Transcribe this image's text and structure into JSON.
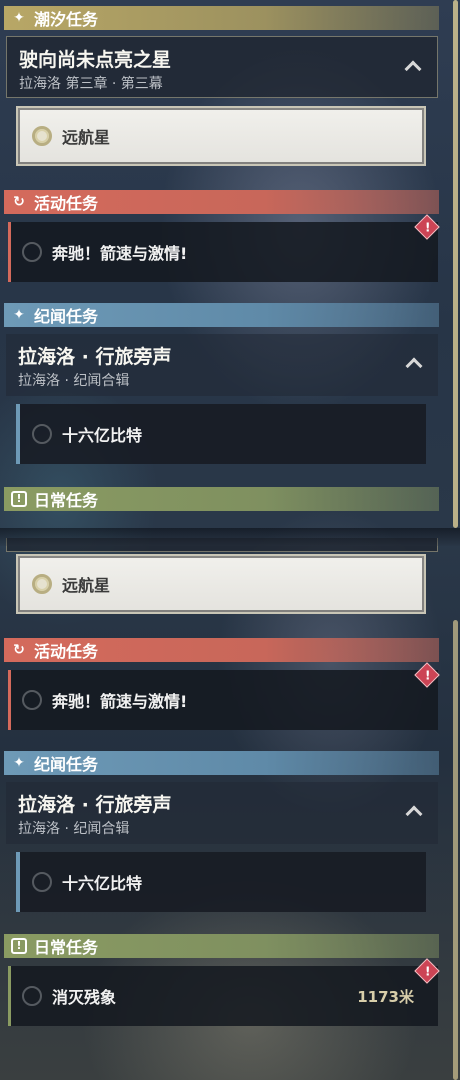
{
  "sections": {
    "tide": {
      "label": "潮汐任务",
      "icon": "sparkle-icon"
    },
    "event": {
      "label": "活动任务",
      "icon": "refresh-icon"
    },
    "story": {
      "label": "纪闻任务",
      "icon": "sparkle-icon"
    },
    "daily": {
      "label": "日常任务",
      "icon": "exclamation-icon"
    }
  },
  "tide_quest": {
    "title": "驶向尚未点亮之星",
    "subtitle": "拉海洛 第三章 · 第三幕",
    "objective": "远航星"
  },
  "event_quest": {
    "title": "奔驰！箭速与激情!",
    "alert": "!"
  },
  "story_quest": {
    "title": "拉海洛 · 行旅旁声",
    "subtitle": "拉海洛 · 纪闻合辑",
    "objective": "十六亿比特"
  },
  "daily_quest": {
    "title": "消灭残象",
    "distance": "1173米",
    "alert": "!"
  },
  "colors": {
    "tide": "#b8a766",
    "event": "#d46a5c",
    "story": "#6e9ab7",
    "daily": "#8a9b62",
    "scrollbar": "#d3c593"
  }
}
